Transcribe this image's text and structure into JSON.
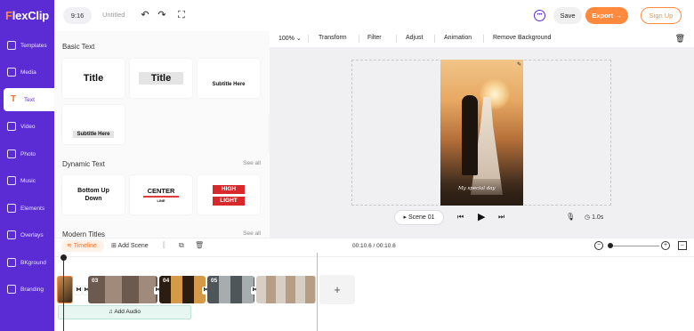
{
  "brand": {
    "name_first": "F",
    "name_rest": "lexClip"
  },
  "sidebar": {
    "items": [
      {
        "label": "Templates",
        "icon": "templates-icon"
      },
      {
        "label": "Media",
        "icon": "media-icon"
      },
      {
        "label": "Text",
        "icon": "text-icon",
        "active": true
      },
      {
        "label": "Video",
        "icon": "video-icon"
      },
      {
        "label": "Photo",
        "icon": "photo-icon"
      },
      {
        "label": "Music",
        "icon": "music-icon"
      },
      {
        "label": "Elements",
        "icon": "elements-icon"
      },
      {
        "label": "Overlays",
        "icon": "overlays-icon"
      },
      {
        "label": "BKground",
        "icon": "background-icon"
      },
      {
        "label": "Branding",
        "icon": "branding-icon"
      }
    ]
  },
  "topbar": {
    "ratio": "9:16",
    "title": "Untitled",
    "save": "Save",
    "export": "Export →",
    "signup": "Sign Up"
  },
  "panel": {
    "basic_title": "Basic Text",
    "basic": {
      "title1": "Title",
      "title2": "Title",
      "sub1": "Subtitle Here",
      "sub2": "Subtitle Here"
    },
    "dynamic_title": "Dynamic Text",
    "see_all": "See all",
    "dynamic": {
      "bud_line1": "Bottom Up",
      "bud_line2": "Down",
      "center": "CENTER",
      "center_sub": "LINE",
      "high": "HIGH",
      "light": "LIGHT"
    },
    "modern_title": "Modern Titles"
  },
  "edit_toolbar": {
    "zoom": "100%",
    "items": [
      "Transform",
      "Filter",
      "Adjust",
      "Animation",
      "Remove Background"
    ]
  },
  "canvas": {
    "script_text": "My special day"
  },
  "player": {
    "scene": "Scene 01",
    "duration": "1.0s"
  },
  "timeline": {
    "tab": "Timeline",
    "add_scene": "Add Scene",
    "time": "00:10.6 / 00:10.6",
    "clips": [
      "03",
      "04",
      "05"
    ],
    "add_audio": "Add Audio",
    "zoom_level": 0.05
  },
  "colors": {
    "accent": "#5b2bd3",
    "orange": "#ff8a3d"
  }
}
